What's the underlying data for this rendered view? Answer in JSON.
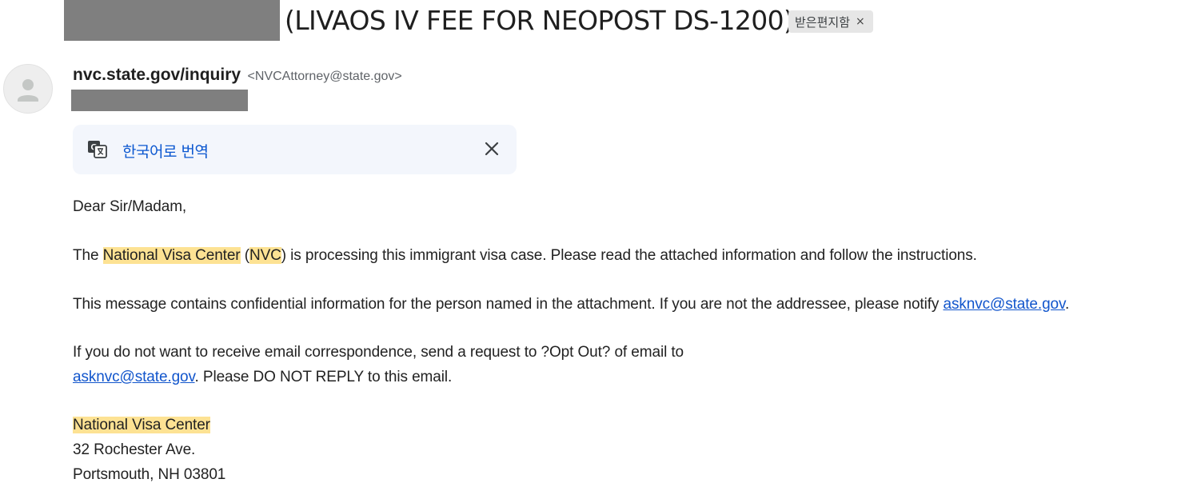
{
  "email": {
    "subject": "(LIVAOS IV FEE FOR NEOPOST DS-1200)",
    "label_chip": {
      "text": "받은편지함",
      "remove": "×"
    },
    "sender": {
      "name": "nvc.state.gov/inquiry",
      "email": "<NVCAttorney@state.gov>"
    },
    "translate": {
      "label": "한국어로 번역"
    },
    "body": {
      "greeting": "Dear Sir/Madam,",
      "p1": {
        "a": "The ",
        "org": "National Visa Center",
        "b": " (",
        "abbr": "NVC",
        "c": ") is processing this immigrant visa case. Please read the attached information and follow the instructions."
      },
      "p2": {
        "a": "This message contains confidential information for the person named in the attachment. If you are not the addressee, please notify ",
        "link": "asknvc@state.gov",
        "b": "."
      },
      "p3": {
        "line1": "If you do not want to receive email correspondence, send a request to ?Opt Out? of email to",
        "link": "asknvc@state.gov",
        "b": ". Please DO NOT REPLY to this email."
      },
      "signature": {
        "org": "National Visa Center",
        "street": "32 Rochester Ave.",
        "city": "Portsmouth, NH 03801"
      }
    }
  },
  "colors": {
    "highlight": "#fde293",
    "link": "#1155cc",
    "translate_link": "#0b57d0",
    "translate_bg": "#f3f6fc",
    "redaction": "#7f7f7f"
  },
  "icons": [
    "translate-icon",
    "close-icon",
    "avatar-person-icon"
  ]
}
